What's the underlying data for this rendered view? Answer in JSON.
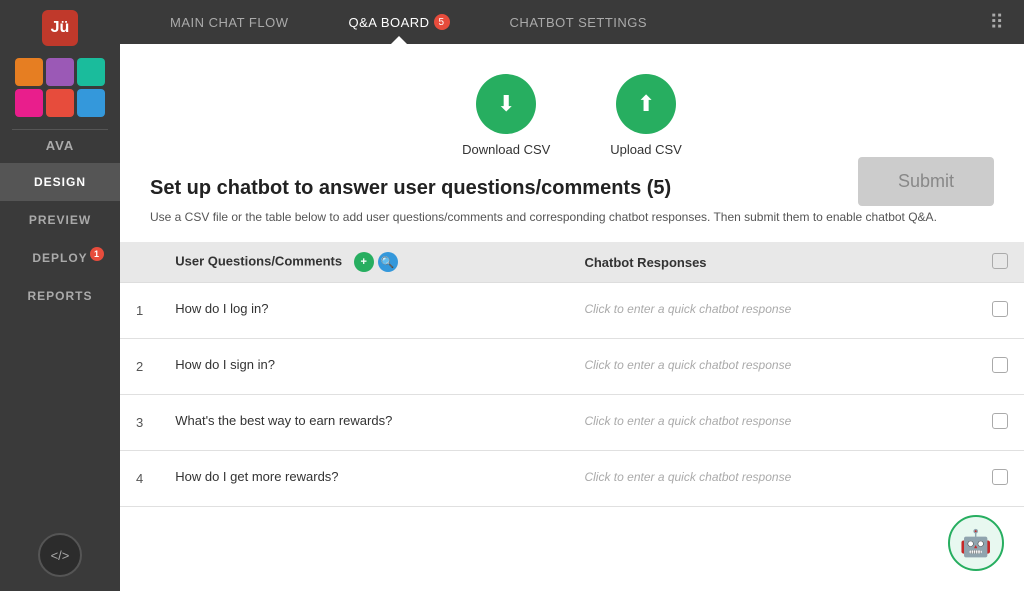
{
  "app": {
    "logo_text": "Jü",
    "user_name": "AVA"
  },
  "sidebar": {
    "nav_items": [
      {
        "id": "design",
        "label": "DESIGN",
        "active": true,
        "badge": null
      },
      {
        "id": "preview",
        "label": "PREVIEW",
        "active": false,
        "badge": null
      },
      {
        "id": "deploy",
        "label": "DEPLOY",
        "active": false,
        "badge": "1"
      },
      {
        "id": "reports",
        "label": "REPORTS",
        "active": false,
        "badge": null
      }
    ],
    "code_btn_label": "</>",
    "avatars": [
      {
        "color": "orange"
      },
      {
        "color": "purple"
      },
      {
        "color": "teal"
      },
      {
        "color": "pink"
      },
      {
        "color": "red"
      },
      {
        "color": "blue"
      }
    ]
  },
  "topnav": {
    "items": [
      {
        "id": "main-chat-flow",
        "label": "MAIN CHAT FLOW",
        "active": false,
        "badge": null
      },
      {
        "id": "qa-board",
        "label": "Q&A BOARD",
        "active": true,
        "badge": "5"
      },
      {
        "id": "chatbot-settings",
        "label": "CHATBOT SETTINGS",
        "active": false,
        "badge": null
      }
    ]
  },
  "csv_section": {
    "download_label": "Download CSV",
    "upload_label": "Upload CSV",
    "download_icon": "⬇",
    "upload_icon": "⬆"
  },
  "instructions": {
    "title": "Set up chatbot to answer user questions/comments (5)",
    "text": "Use a CSV file or the table below to add user questions/comments and\ncorresponding chatbot responses. Then submit them to enable chatbot Q&A.",
    "submit_label": "Submit"
  },
  "table": {
    "col_questions": "User Questions/Comments",
    "col_responses": "Chatbot Responses",
    "response_placeholder": "Click to enter a quick chatbot response",
    "rows": [
      {
        "num": 1,
        "question": "How do I log in?"
      },
      {
        "num": 2,
        "question": "How do I sign in?"
      },
      {
        "num": 3,
        "question": "What's the best way to earn rewards?"
      },
      {
        "num": 4,
        "question": "How do I get more rewards?"
      }
    ]
  }
}
